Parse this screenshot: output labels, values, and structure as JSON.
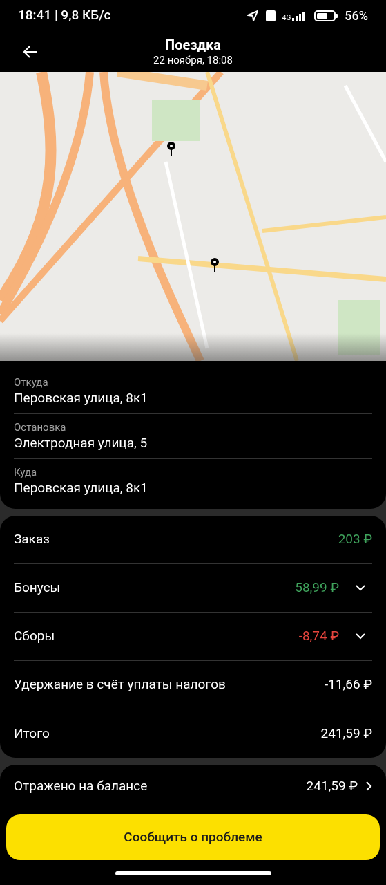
{
  "status_bar": {
    "time_speed": "18:41 | 9,8 КБ/с",
    "network": "4G",
    "battery": "56%"
  },
  "header": {
    "title": "Поездка",
    "subtitle": "22 ноября, 18:08"
  },
  "route": [
    {
      "label": "Откуда",
      "address": "Перовская улица, 8к1"
    },
    {
      "label": "Остановка",
      "address": "Электродная улица, 5"
    },
    {
      "label": "Куда",
      "address": "Перовская улица, 8к1"
    }
  ],
  "payment": [
    {
      "label": "Заказ",
      "amount": "203 ₽",
      "color": "#3fa35c",
      "expandable": false
    },
    {
      "label": "Бонусы",
      "amount": "58,99 ₽",
      "color": "#3fa35c",
      "expandable": true
    },
    {
      "label": "Сборы",
      "amount": "-8,74 ₽",
      "color": "#e5453d",
      "expandable": true
    },
    {
      "label": "Удержание в счёт уплаты налогов",
      "amount": "-11,66 ₽",
      "color": "#ffffff",
      "expandable": false
    },
    {
      "label": "Итого",
      "amount": "241,59 ₽",
      "color": "#ffffff",
      "expandable": false
    }
  ],
  "balance": {
    "label": "Отражено на балансе",
    "amount": "241,59 ₽"
  },
  "report_button": "Сообщить о проблеме"
}
